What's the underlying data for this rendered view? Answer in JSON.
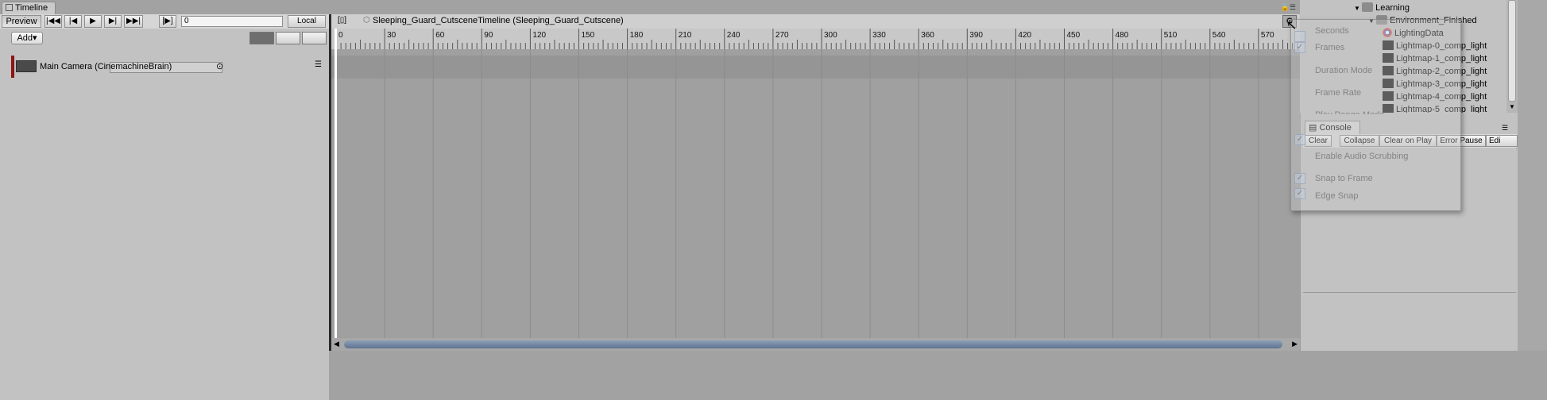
{
  "window": {
    "tab_label": "Timeline"
  },
  "toolbar": {
    "preview_label": "Preview",
    "frame_value": "0",
    "local_label": "Local",
    "add_label": "Add▾"
  },
  "breadcrumb": {
    "label": "Sleeping_Guard_CutsceneTimeline (Sleeping_Guard_Cutscene)"
  },
  "track": {
    "name": "Main Camera (CinemachineBrain)"
  },
  "ruler": {
    "ticks": [
      "0",
      "30",
      "60",
      "90",
      "120",
      "150",
      "180",
      "210",
      "240",
      "270",
      "300",
      "330",
      "360",
      "390",
      "420",
      "450",
      "480",
      "510",
      "540",
      "570"
    ]
  },
  "hierarchy": {
    "items": [
      {
        "label": "Learning",
        "icon": "folder-icon"
      },
      {
        "label": "Environment_Finished",
        "icon": "folder-icon"
      },
      {
        "label": "LightingData",
        "icon": "lighting-data-icon"
      },
      {
        "label": "Lightmap-0_comp_light",
        "icon": "texture-icon"
      },
      {
        "label": "Lightmap-1_comp_light",
        "icon": "texture-icon"
      },
      {
        "label": "Lightmap-2_comp_light",
        "icon": "texture-icon"
      },
      {
        "label": "Lightmap-3_comp_light",
        "icon": "texture-icon"
      },
      {
        "label": "Lightmap-4_comp_light",
        "icon": "texture-icon"
      },
      {
        "label": "Lightmap-5_comp_light",
        "icon": "texture-icon"
      }
    ]
  },
  "console": {
    "tab_label": "Console",
    "clear_label": "Clear",
    "collapse_label": "Collapse",
    "clear_on_play_label": "Clear on Play",
    "error_pause_label": "Error Pause",
    "editor_label": "Edi"
  },
  "settings_menu": {
    "seconds": "Seconds",
    "frames": "Frames",
    "duration_mode": "Duration Mode",
    "frame_rate": "Frame Rate",
    "play_range_mode": "Play Range Mode",
    "enable_audio_scrubbing": "Enable Audio Scrubbing",
    "snap_to_frame": "Snap to Frame",
    "edge_snap": "Edge Snap"
  }
}
